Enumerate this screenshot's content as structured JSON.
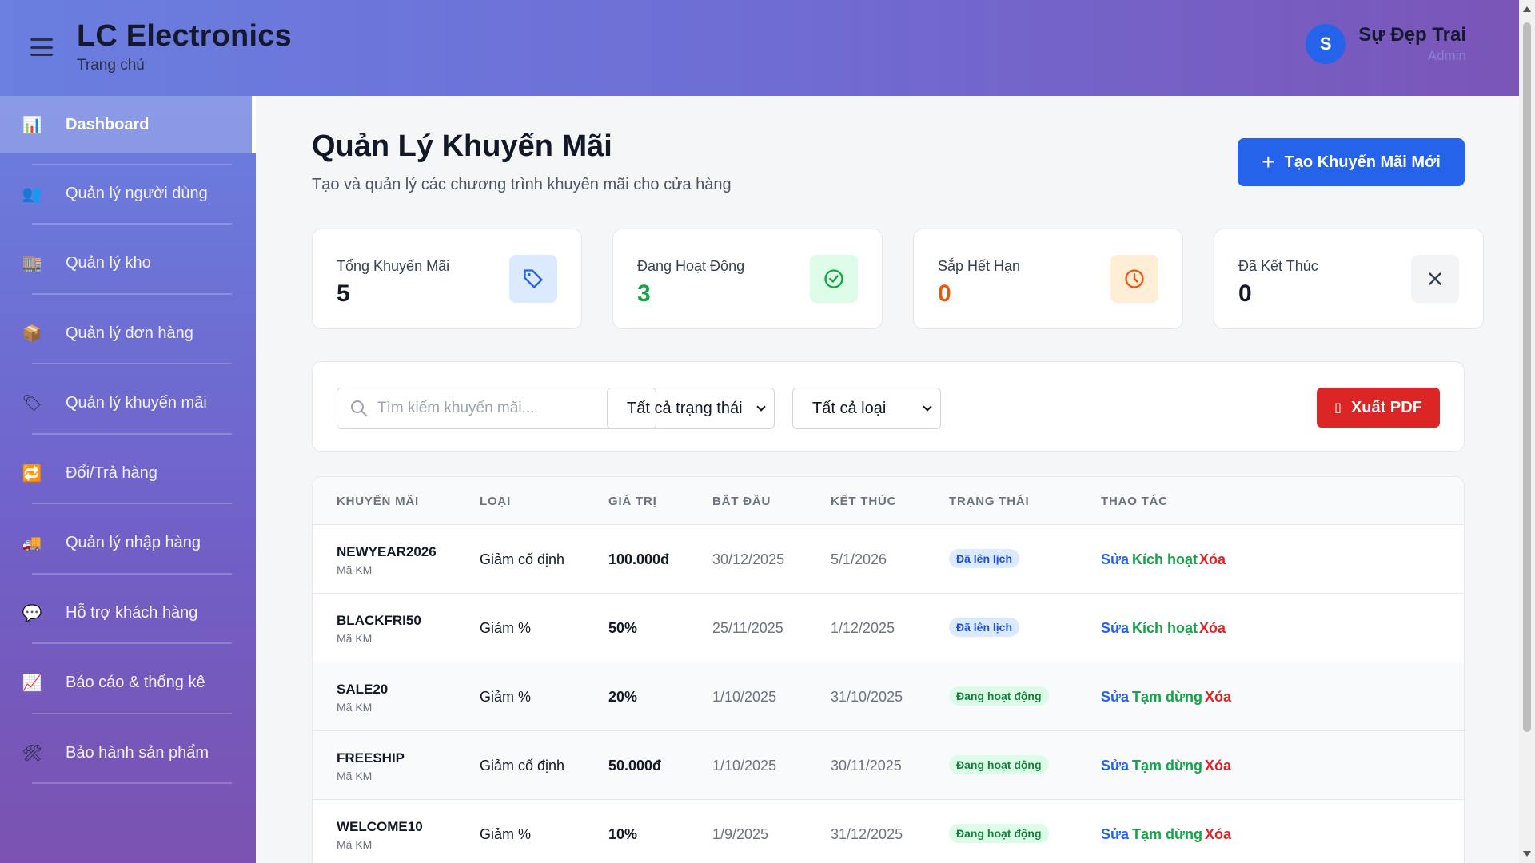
{
  "header": {
    "brand": "LC Electronics",
    "subtitle": "Trang chủ",
    "user": {
      "initial": "S",
      "name": "Sự Đẹp Trai",
      "role": "Admin"
    }
  },
  "sidebar": {
    "items": [
      {
        "label": "Dashboard",
        "icon": "chart-icon",
        "glyph": "📊",
        "active": true
      },
      {
        "label": "Quản lý người dùng",
        "icon": "users-icon",
        "glyph": "👥"
      },
      {
        "label": "Quản lý kho",
        "icon": "warehouse-icon",
        "glyph": "🏬"
      },
      {
        "label": "Quản lý đơn hàng",
        "icon": "package-icon",
        "glyph": "📦"
      },
      {
        "label": "Quản lý khuyến mãi",
        "icon": "tag-icon",
        "glyph": "🏷"
      },
      {
        "label": "Đổi/Trả hàng",
        "icon": "exchange-icon",
        "glyph": "🔁"
      },
      {
        "label": "Quản lý nhập hàng",
        "icon": "truck-icon",
        "glyph": "🚚"
      },
      {
        "label": "Hỗ trợ khách hàng",
        "icon": "chat-icon",
        "glyph": "💬"
      },
      {
        "label": "Báo cáo & thống kê",
        "icon": "trend-icon",
        "glyph": "📈"
      },
      {
        "label": "Bảo hành sản phẩm",
        "icon": "tools-icon",
        "glyph": "🛠"
      }
    ]
  },
  "main": {
    "title": "Quản Lý Khuyến Mãi",
    "description": "Tạo và quản lý các chương trình khuyến mãi cho cửa hàng",
    "create_button": "Tạo Khuyến Mãi Mới",
    "stats": [
      {
        "label": "Tổng Khuyến Mãi",
        "value": "5",
        "color": "#111827",
        "icon": "tag-icon",
        "bg": "#dbeafe",
        "fg": "#2563eb"
      },
      {
        "label": "Đang Hoạt Động",
        "value": "3",
        "color": "#16a34a",
        "icon": "check-circle-icon",
        "bg": "#dcfce7",
        "fg": "#16a34a"
      },
      {
        "label": "Sắp Hết Hạn",
        "value": "0",
        "color": "#ea580c",
        "icon": "clock-icon",
        "bg": "#ffedd5",
        "fg": "#ea580c"
      },
      {
        "label": "Đã Kết Thúc",
        "value": "0",
        "color": "#111827",
        "icon": "close-icon",
        "bg": "#f3f4f6",
        "fg": "#374151"
      }
    ],
    "filters": {
      "search_placeholder": "Tìm kiếm khuyến mãi...",
      "status_select": "Tất cả trạng thái",
      "type_select": "Tất cả loại",
      "export_button": "Xuất PDF"
    },
    "table": {
      "headers": [
        "KHUYẾN MÃI",
        "LOẠI",
        "GIÁ TRỊ",
        "BẮT ĐẦU",
        "KẾT THÚC",
        "TRẠNG THÁI",
        "THAO TÁC"
      ],
      "code_sub": "Mã KM",
      "rows": [
        {
          "code": "NEWYEAR2026",
          "type": "Giảm cố định",
          "value": "100.000đ",
          "start": "30/12/2025",
          "end": "5/1/2026",
          "status": "Đã lên lịch",
          "status_kind": "scheduled",
          "edit": "Sửa",
          "toggle": "Kích hoạt",
          "delete": "Xóa"
        },
        {
          "code": "BLACKFRI50",
          "type": "Giảm %",
          "value": "50%",
          "start": "25/11/2025",
          "end": "1/12/2025",
          "status": "Đã lên lịch",
          "status_kind": "scheduled",
          "edit": "Sửa",
          "toggle": "Kích hoạt",
          "delete": "Xóa"
        },
        {
          "code": "SALE20",
          "type": "Giảm %",
          "value": "20%",
          "start": "1/10/2025",
          "end": "31/10/2025",
          "status": "Đang hoạt động",
          "status_kind": "active",
          "edit": "Sửa",
          "toggle": "Tạm dừng",
          "delete": "Xóa"
        },
        {
          "code": "FREESHIP",
          "type": "Giảm cố định",
          "value": "50.000đ",
          "start": "1/10/2025",
          "end": "30/11/2025",
          "status": "Đang hoạt động",
          "status_kind": "active",
          "edit": "Sửa",
          "toggle": "Tạm dừng",
          "delete": "Xóa"
        },
        {
          "code": "WELCOME10",
          "type": "Giảm %",
          "value": "10%",
          "start": "1/9/2025",
          "end": "31/12/2025",
          "status": "Đang hoạt động",
          "status_kind": "active",
          "edit": "Sửa",
          "toggle": "Tạm dừng",
          "delete": "Xóa"
        }
      ]
    }
  }
}
